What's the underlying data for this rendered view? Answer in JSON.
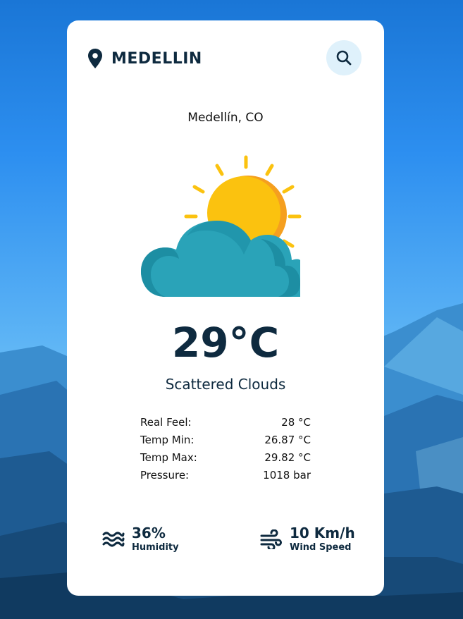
{
  "header": {
    "city": "MEDELLIN",
    "search_icon": "search-icon",
    "pin_icon": "map-pin-icon"
  },
  "location": "Medellín, CO",
  "current": {
    "temperature": "29°C",
    "description": "Scattered Clouds",
    "icon": "sun-behind-cloud-icon"
  },
  "details": [
    {
      "label": "Real Feel:",
      "value": "28 °C"
    },
    {
      "label": "Temp Min:",
      "value": "26.87 °C"
    },
    {
      "label": "Temp Max:",
      "value": "29.82 °C"
    },
    {
      "label": "Pressure:",
      "value": "1018 bar"
    }
  ],
  "stats": {
    "humidity": {
      "value": "36%",
      "label": "Humidity",
      "icon": "waves-icon"
    },
    "wind": {
      "value": "10 Km/h",
      "label": "Wind Speed",
      "icon": "wind-icon"
    }
  },
  "colors": {
    "text_dark": "#0e2a3f",
    "search_bg": "#dff1fb",
    "sun": "#fbc20f",
    "sun_shadow": "#f59f1f",
    "cloud": "#2aa3b8",
    "cloud_shadow": "#1d8ea3"
  }
}
